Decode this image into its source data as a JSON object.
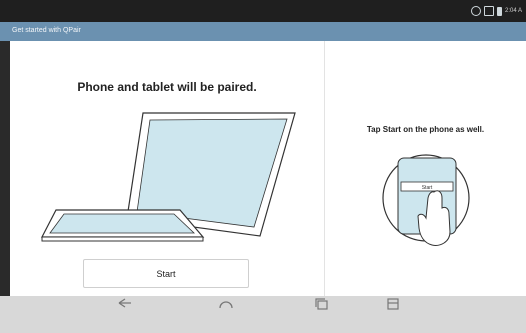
{
  "status_bar": {
    "time": "2:04 A"
  },
  "title_bar": {
    "title": "Get started with QPair"
  },
  "left_panel": {
    "heading": "Phone and tablet will be paired.",
    "start_label": "Start"
  },
  "right_panel": {
    "heading": "Tap Start on the phone as well.",
    "illustration_button_label": "Start"
  },
  "nav_bar": {
    "icons": [
      "back-icon",
      "home-icon",
      "recent-apps-icon",
      "menu-icon"
    ]
  },
  "colors": {
    "title_bar": "#6b91b0",
    "screen_fill": "#cde6ee",
    "nav_bar": "#d8d8d8"
  }
}
